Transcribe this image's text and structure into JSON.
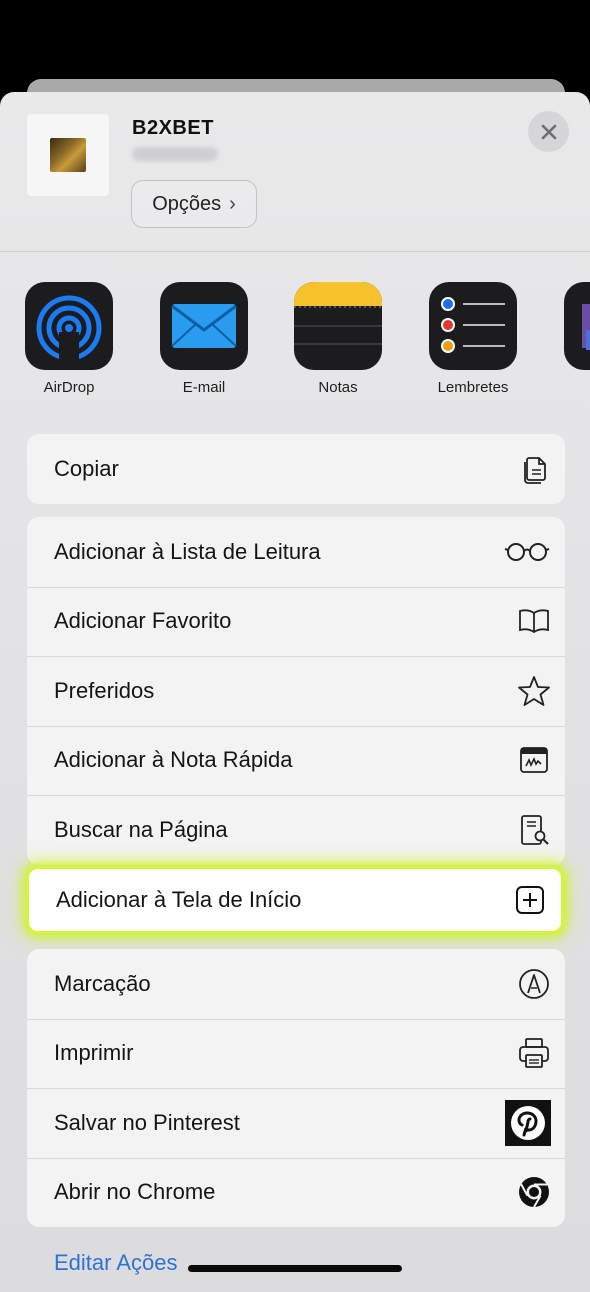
{
  "header": {
    "title": "B2XBET",
    "options_label": "Opções",
    "options_chevron": "›"
  },
  "apps": [
    {
      "label": "AirDrop",
      "icon": "airdrop-icon"
    },
    {
      "label": "E-mail",
      "icon": "mail-icon"
    },
    {
      "label": "Notas",
      "icon": "notes-icon"
    },
    {
      "label": "Lembretes",
      "icon": "reminders-icon"
    },
    {
      "label": "",
      "icon": "partial-app-icon"
    }
  ],
  "groups": {
    "copy": [
      {
        "label": "Copiar",
        "icon": "copy-icon"
      }
    ],
    "actions": [
      {
        "label": "Adicionar à Lista de Leitura",
        "icon": "glasses-icon"
      },
      {
        "label": "Adicionar Favorito",
        "icon": "book-icon"
      },
      {
        "label": "Preferidos",
        "icon": "star-icon"
      },
      {
        "label": "Adicionar à Nota Rápida",
        "icon": "quick-note-icon"
      },
      {
        "label": "Buscar na Página",
        "icon": "find-in-page-icon"
      }
    ],
    "highlighted": {
      "label": "Adicionar à Tela de Início",
      "icon": "add-square-icon"
    },
    "more": [
      {
        "label": "Marcação",
        "icon": "markup-icon"
      },
      {
        "label": "Imprimir",
        "icon": "printer-icon"
      },
      {
        "label": "Salvar no Pinterest",
        "icon": "pinterest-icon"
      },
      {
        "label": "Abrir no Chrome",
        "icon": "chrome-icon"
      }
    ]
  },
  "footer": {
    "edit_actions_label": "Editar Ações"
  },
  "colors": {
    "highlight_glow": "#d5f53a",
    "link": "#2f72d6",
    "sheet_bg": "#e6e6e8"
  }
}
